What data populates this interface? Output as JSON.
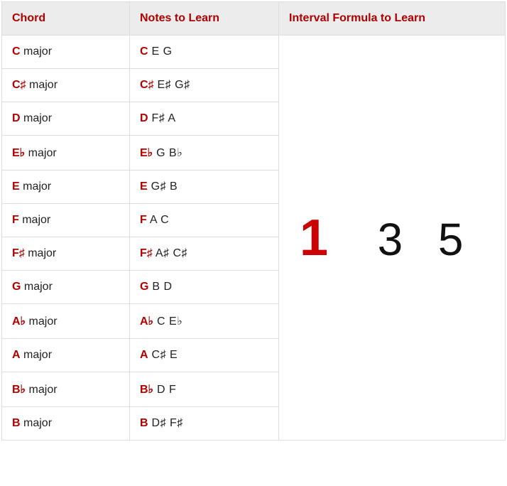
{
  "headers": {
    "chord": "Chord",
    "notes": "Notes to Learn",
    "formula": "Interval Formula to Learn"
  },
  "formula": {
    "a": "1",
    "b": "3",
    "c": "5"
  },
  "rows": [
    {
      "root": "C",
      "type": " major",
      "notes_root": "C",
      "notes_rest": "  E  G"
    },
    {
      "root": "C♯",
      "type": " major",
      "notes_root": "C♯",
      "notes_rest": "  E♯  G♯"
    },
    {
      "root": "D",
      "type": " major",
      "notes_root": "D",
      "notes_rest": "  F♯  A"
    },
    {
      "root": "E♭",
      "type": " major",
      "notes_root": "E♭",
      "notes_rest": "  G  B♭"
    },
    {
      "root": "E",
      "type": " major",
      "notes_root": "E",
      "notes_rest": "  G♯  B"
    },
    {
      "root": "F",
      "type": " major",
      "notes_root": "F",
      "notes_rest": "  A  C"
    },
    {
      "root": "F♯",
      "type": " major",
      "notes_root": "F♯",
      "notes_rest": "  A♯  C♯"
    },
    {
      "root": "G",
      "type": " major",
      "notes_root": "G",
      "notes_rest": "  B  D"
    },
    {
      "root": "A♭",
      "type": " major",
      "notes_root": "A♭",
      "notes_rest": "  C  E♭"
    },
    {
      "root": "A",
      "type": " major",
      "notes_root": "A",
      "notes_rest": "  C♯  E"
    },
    {
      "root": "B♭",
      "type": " major",
      "notes_root": "B♭",
      "notes_rest": "  D  F"
    },
    {
      "root": "B",
      "type": " major",
      "notes_root": "B",
      "notes_rest": "  D♯  F♯"
    }
  ]
}
